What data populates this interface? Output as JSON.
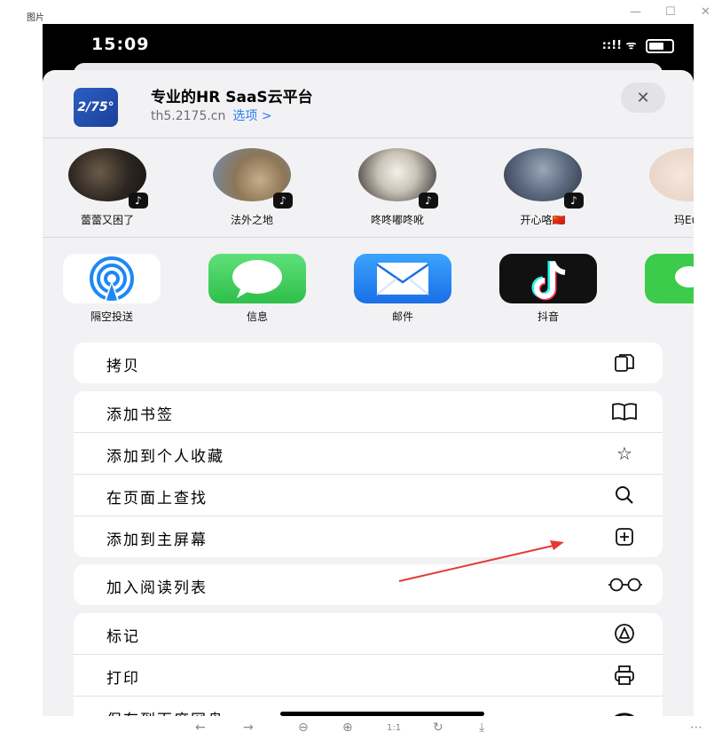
{
  "window": {
    "title": "图片",
    "minimize": "—",
    "maximize": "☐",
    "close": "✕"
  },
  "status_bar": {
    "time": "15:09",
    "signal": "::!!",
    "wifi": "ᯤ"
  },
  "share_header": {
    "icon_text": "2/75°",
    "title": "专业的HR SaaS云平台",
    "url": "th5.2175.cn",
    "options": "选项 >",
    "close": "✕"
  },
  "contacts": [
    {
      "name": "蕾蕾又困了",
      "color": "#4a4038"
    },
    {
      "name": "法外之地",
      "color": "#a89070"
    },
    {
      "name": "咚咚嘟咚吪",
      "color": "#c9c2b6"
    },
    {
      "name": "开心咯🇨🇳",
      "color": "#5c6a80"
    },
    {
      "name": "玛Eut",
      "color": "#e8d3c7"
    }
  ],
  "apps": [
    {
      "name": "隔空投送",
      "icon": "airdrop-icon"
    },
    {
      "name": "信息",
      "icon": "messages-icon"
    },
    {
      "name": "邮件",
      "icon": "mail-icon"
    },
    {
      "name": "抖音",
      "icon": "douyin-icon"
    },
    {
      "name": "",
      "icon": "wechat-icon"
    }
  ],
  "actions": {
    "copy": "拷贝",
    "bookmark": "添加书签",
    "favorites": "添加到个人收藏",
    "find": "在页面上查找",
    "home_screen": "添加到主屏幕",
    "reading_list": "加入阅读列表",
    "markup": "标记",
    "print": "打印",
    "baidu": "保存到百度网盘"
  },
  "viewer_toolbar": {
    "back": "←",
    "forward": "→",
    "zoom_out": "⊖",
    "zoom_in": "⊕",
    "actual": "1:1",
    "rotate": "↻",
    "download": "⤓",
    "more": "⋯"
  },
  "colors": {
    "accent_blue": "#2f7cf6",
    "messages_green": "#34c759",
    "mail_blue": "#1e88f5",
    "arrow_red": "#e53935"
  }
}
